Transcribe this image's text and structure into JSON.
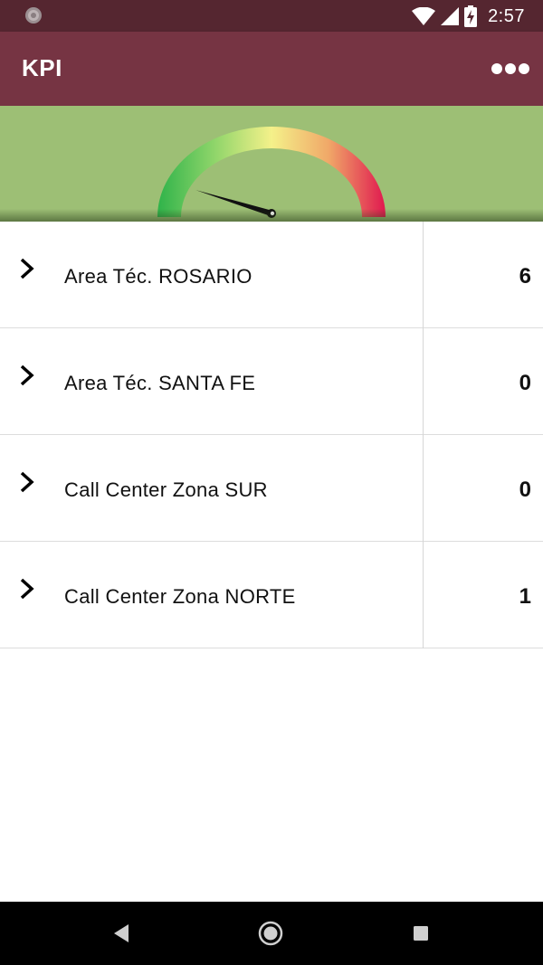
{
  "status_bar": {
    "time": "2:57",
    "icons": [
      "notification-icon",
      "wifi-icon",
      "signal-icon",
      "battery-charging-icon"
    ]
  },
  "app_bar": {
    "title": "KPI",
    "menu_icon": "more-icon"
  },
  "gauge": {
    "needle_level": 0.1,
    "colors": {
      "background": "#9dbf75",
      "low": "#2fb34a",
      "mid": "#f4f18a",
      "high": "#e0184f",
      "needle": "#111111"
    }
  },
  "list": {
    "rows": [
      {
        "label": "Area Téc. ROSARIO",
        "value": "6"
      },
      {
        "label": "Area Téc. SANTA FE",
        "value": "0"
      },
      {
        "label": "Call Center Zona SUR",
        "value": "0"
      },
      {
        "label": "Call Center Zona NORTE",
        "value": "1"
      }
    ]
  },
  "nav_bar": {
    "icons": [
      "back-icon",
      "home-icon",
      "recents-icon"
    ]
  },
  "theme": {
    "primary": "#763443",
    "primary_dark": "#552630"
  }
}
